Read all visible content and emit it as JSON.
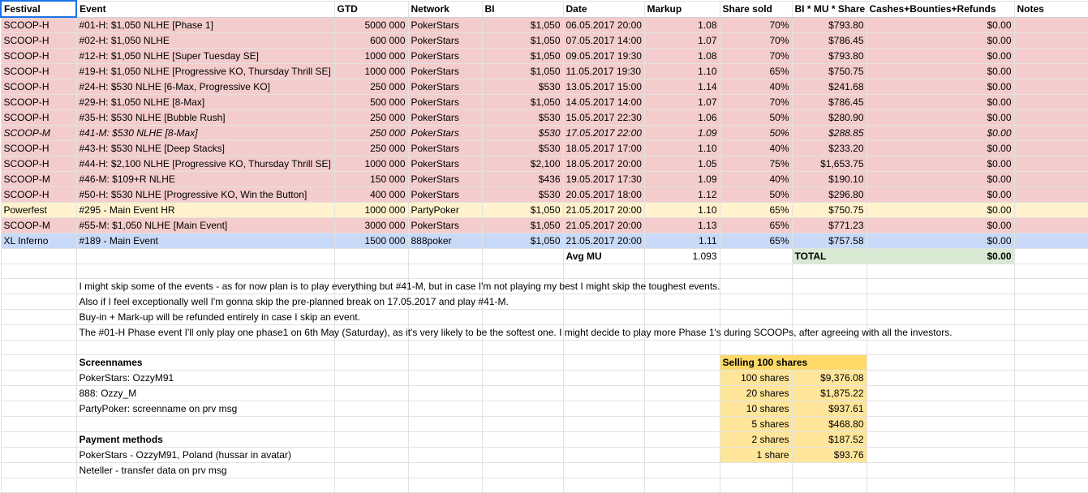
{
  "headers": [
    "Festival",
    "Event",
    "GTD",
    "Network",
    "BI",
    "Date",
    "Markup",
    "Share sold",
    "BI * MU * Share",
    "Cashes+Bounties+Refunds",
    "Notes"
  ],
  "rows": [
    {
      "style": "pink",
      "cells": [
        "SCOOP-H",
        "#01-H: $1,050 NLHE [Phase 1]",
        "5000 000",
        "PokerStars",
        "$1,050",
        "06.05.2017 20:00",
        "1.08",
        "70%",
        "$793.80",
        "$0.00",
        ""
      ]
    },
    {
      "style": "pink",
      "cells": [
        "SCOOP-H",
        "#02-H: $1,050 NLHE",
        "600 000",
        "PokerStars",
        "$1,050",
        "07.05.2017 14:00",
        "1.07",
        "70%",
        "$786.45",
        "$0.00",
        ""
      ]
    },
    {
      "style": "pink",
      "cells": [
        "SCOOP-H",
        "#12-H: $1,050 NLHE [Super Tuesday SE]",
        "1000 000",
        "PokerStars",
        "$1,050",
        "09.05.2017 19:30",
        "1.08",
        "70%",
        "$793.80",
        "$0.00",
        ""
      ]
    },
    {
      "style": "pink",
      "cells": [
        "SCOOP-H",
        "#19-H: $1,050 NLHE [Progressive KO, Thursday Thrill SE]",
        "1000 000",
        "PokerStars",
        "$1,050",
        "11.05.2017 19:30",
        "1.10",
        "65%",
        "$750.75",
        "$0.00",
        ""
      ]
    },
    {
      "style": "pink",
      "cells": [
        "SCOOP-H",
        "#24-H: $530 NLHE [6-Max, Progressive KO]",
        "250 000",
        "PokerStars",
        "$530",
        "13.05.2017 15:00",
        "1.14",
        "40%",
        "$241.68",
        "$0.00",
        ""
      ]
    },
    {
      "style": "pink",
      "cells": [
        "SCOOP-H",
        "#29-H: $1,050 NLHE [8-Max]",
        "500 000",
        "PokerStars",
        "$1,050",
        "14.05.2017 14:00",
        "1.07",
        "70%",
        "$786.45",
        "$0.00",
        ""
      ]
    },
    {
      "style": "pink",
      "cells": [
        "SCOOP-H",
        "#35-H: $530 NLHE [Bubble Rush]",
        "250 000",
        "PokerStars",
        "$530",
        "15.05.2017 22:30",
        "1.06",
        "50%",
        "$280.90",
        "$0.00",
        ""
      ]
    },
    {
      "style": "pink italic",
      "cells": [
        "SCOOP-M",
        "#41-M: $530 NLHE [8-Max]",
        "250 000",
        "PokerStars",
        "$530",
        "17.05.2017 22:00",
        "1.09",
        "50%",
        "$288.85",
        "$0.00",
        ""
      ]
    },
    {
      "style": "pink",
      "cells": [
        "SCOOP-H",
        "#43-H: $530 NLHE [Deep Stacks]",
        "250 000",
        "PokerStars",
        "$530",
        "18.05.2017 17:00",
        "1.10",
        "40%",
        "$233.20",
        "$0.00",
        ""
      ]
    },
    {
      "style": "pink",
      "cells": [
        "SCOOP-H",
        "#44-H: $2,100 NLHE [Progressive KO, Thursday Thrill SE]",
        "1000 000",
        "PokerStars",
        "$2,100",
        "18.05.2017 20:00",
        "1.05",
        "75%",
        "$1,653.75",
        "$0.00",
        ""
      ]
    },
    {
      "style": "pink",
      "cells": [
        "SCOOP-M",
        "#46-M: $109+R NLHE",
        "150 000",
        "PokerStars",
        "$436",
        "19.05.2017 17:30",
        "1.09",
        "40%",
        "$190.10",
        "$0.00",
        ""
      ]
    },
    {
      "style": "pink",
      "cells": [
        "SCOOP-H",
        "#50-H: $530 NLHE [Progressive KO, Win the Button]",
        "400 000",
        "PokerStars",
        "$530",
        "20.05.2017 18:00",
        "1.12",
        "50%",
        "$296.80",
        "$0.00",
        ""
      ]
    },
    {
      "style": "yellow",
      "cells": [
        "Powerfest",
        "#295 - Main Event HR",
        "1000 000",
        "PartyPoker",
        "$1,050",
        "21.05.2017 20:00",
        "1.10",
        "65%",
        "$750.75",
        "$0.00",
        ""
      ]
    },
    {
      "style": "pink",
      "cells": [
        "SCOOP-M",
        "#55-M: $1,050 NLHE [Main Event]",
        "3000 000",
        "PokerStars",
        "$1,050",
        "21.05.2017 20:00",
        "1.13",
        "65%",
        "$771.23",
        "$0.00",
        ""
      ]
    },
    {
      "style": "blue",
      "cells": [
        "XL Inferno",
        "#189 - Main Event",
        "1500 000",
        "888poker",
        "$1,050",
        "21.05.2017 20:00",
        "1.11",
        "65%",
        "$757.58",
        "$0.00",
        ""
      ]
    }
  ],
  "summary": {
    "avg_label": "Avg MU",
    "avg_value": "1.093",
    "total_label": "TOTAL",
    "total_value": "$0.00"
  },
  "notes": [
    "I might skip some of the events - as for now plan is to play everything but #41-M, but in case I'm not playing my best I might skip the toughest events.",
    "Also if I feel exceptionally well I'm gonna skip the pre-planned break on 17.05.2017 and play #41-M.",
    "Buy-in + Mark-up will be refunded entirely in case I skip an event.",
    "The #01-H Phase event I'll only play one phase1 on 6th May (Saturday), as it's very likely to be the softest one. I might decide to play more Phase 1's during SCOOPs, after agreeing with all the investors."
  ],
  "screennames": {
    "title": "Screennames",
    "items": [
      "PokerStars: OzzyM91",
      "888: Ozzy_M",
      "PartyPoker: screenname on prv msg"
    ]
  },
  "payment": {
    "title": "Payment methods",
    "items": [
      "PokerStars - OzzyM91, Poland (hussar in avatar)",
      "Neteller - transfer data on prv msg"
    ]
  },
  "selling": {
    "title": "Selling 100 shares",
    "rows": [
      [
        "100 shares",
        "$9,376.08"
      ],
      [
        "20 shares",
        "$1,875.22"
      ],
      [
        "10 shares",
        "$937.61"
      ],
      [
        "5 shares",
        "$468.80"
      ],
      [
        "2 shares",
        "$187.52"
      ],
      [
        "1 share",
        "$93.76"
      ]
    ]
  },
  "colors": {
    "pink": "#f4cccc",
    "yellow": "#fff2cc",
    "blue": "#c9daf8",
    "green": "#d9ead3",
    "orange": "#ffe599",
    "orange_header": "#ffd966"
  }
}
